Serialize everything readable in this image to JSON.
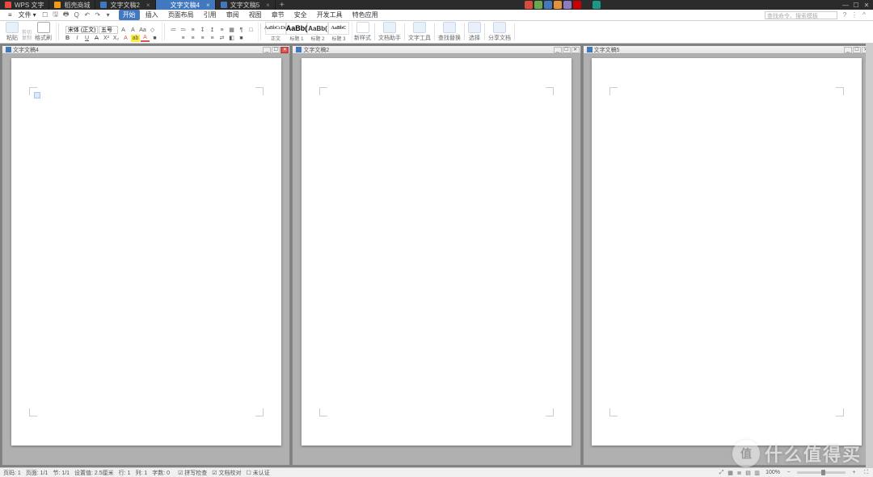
{
  "top_tabs": [
    {
      "label": "WPS 文字",
      "icon": "wps"
    },
    {
      "label": "稻壳商城",
      "icon": "mall"
    },
    {
      "label": "文字文稿2",
      "icon": "doc",
      "close": "×"
    },
    {
      "label": "文字文稿4",
      "icon": "doc",
      "close": "×"
    },
    {
      "label": "文字文稿5",
      "icon": "doc",
      "close": "×"
    }
  ],
  "top_tabs_active_index": 3,
  "tab_add_glyph": "+",
  "win": {
    "min": "—",
    "max": "☐",
    "close": "✕"
  },
  "tray_colors": [
    "#d94b3c",
    "#6aa84f",
    "#4178be",
    "#e69138",
    "#8e7cc3",
    "#cc0000",
    "#2b2b2b",
    "#1a9988"
  ],
  "tray_labels": [
    "sogou-input",
    "zh-lang",
    "sync",
    "updates",
    "network",
    "sound",
    "tray1",
    "tray2"
  ],
  "menu": {
    "hamburger": "≡",
    "file": "文件",
    "file_arrow": "▾",
    "qat": [
      {
        "g": "☐",
        "name": "qat-new"
      },
      {
        "g": "🖫",
        "name": "qat-save"
      },
      {
        "g": "🖶",
        "name": "qat-print"
      },
      {
        "g": "Q",
        "name": "qat-preview"
      },
      {
        "g": "↶",
        "name": "qat-undo"
      },
      {
        "g": "↷",
        "name": "qat-redo"
      },
      {
        "g": "▾",
        "name": "qat-more"
      }
    ],
    "tabs": [
      "开始",
      "插入",
      "页面布局",
      "引用",
      "审阅",
      "视图",
      "章节",
      "安全",
      "开发工具",
      "特色应用"
    ],
    "tab_sel": 0,
    "search_placeholder": "查找命令、搜索模板",
    "right_icons": [
      {
        "g": "?",
        "name": "help-icon"
      },
      {
        "g": "⋮",
        "name": "options-icon"
      },
      {
        "g": "^",
        "name": "collapse-ribbon-icon"
      }
    ]
  },
  "ribbon": {
    "paste": {
      "label": "粘贴",
      "cut": "剪切",
      "copy": "复制",
      "brush": "格式刷"
    },
    "font": {
      "name": "宋体 (正文)",
      "size": "五号",
      "grow": "A",
      "shrink": "A",
      "case": "Aa",
      "clear": "◇",
      "bold": "B",
      "italic": "I",
      "under": "U",
      "strike": "A",
      "x2": "X²",
      "x_": "X₂",
      "artA": "A",
      "hilite": "ab",
      "color": "A",
      "shade": "■"
    },
    "para": {
      "r1": [
        "≔",
        "≕",
        "≡",
        "↧",
        "↥",
        "≡",
        "▦",
        "¶",
        "□"
      ],
      "r1_names": [
        "bullets",
        "numbering",
        "multilevel",
        "decrease-indent",
        "increase-indent",
        "line-spacing",
        "borders",
        "show-marks",
        "task-pane"
      ],
      "r2": [
        "≡",
        "≡",
        "≡",
        "≡",
        "⇄",
        "◧",
        "■"
      ],
      "r2_names": [
        "align-left",
        "align-center",
        "align-right",
        "justify",
        "distribute",
        "indent",
        "shading"
      ]
    },
    "styles": {
      "boxes": [
        "AaBbCcDd",
        "AaBb(",
        "AaBb(",
        "AaBbC"
      ],
      "labels": [
        "正文",
        "标题 1",
        "标题 2",
        "标题 3"
      ],
      "new_style": "新样式"
    },
    "right_groups": [
      {
        "label": "文档助手",
        "name": "doc-assistant"
      },
      {
        "label": "文字工具",
        "name": "text-tools"
      },
      {
        "label": "查找替换",
        "name": "find-replace"
      },
      {
        "label": "选择",
        "name": "select"
      },
      {
        "label": "分享文档",
        "name": "share-doc"
      }
    ]
  },
  "mdi_children": [
    {
      "title": "文字文稿4",
      "active": true,
      "has_cursor": true
    },
    {
      "title": "文字文稿2",
      "active": false,
      "has_cursor": false
    },
    {
      "title": "文字文稿5",
      "active": false,
      "has_cursor": false
    }
  ],
  "child_ctl": {
    "min": "_",
    "max": "☐",
    "close": "✕"
  },
  "status": {
    "left": [
      "页码: 1",
      "页面: 1/1",
      "节: 1/1",
      "设置值: 2.5厘米",
      "行: 1",
      "列: 1",
      "字数: 0"
    ],
    "checks": [
      {
        "g": "☑",
        "label": "拼写检查"
      },
      {
        "g": "☑",
        "label": "文档校对"
      },
      {
        "g": "☐",
        "label": "未认证"
      }
    ],
    "view_icons": [
      {
        "g": "⤢",
        "name": "view-fullscreen"
      },
      {
        "g": "▦",
        "name": "view-print-layout"
      },
      {
        "g": "≣",
        "name": "view-outline"
      },
      {
        "g": "▤",
        "name": "view-web"
      },
      {
        "g": "▥",
        "name": "view-reading"
      }
    ],
    "zoom_pct": "100%",
    "zoom_minus": "−",
    "zoom_plus": "+",
    "fullscreen": "⛶"
  },
  "watermark": {
    "badge": "值",
    "text": "什么值得买"
  }
}
